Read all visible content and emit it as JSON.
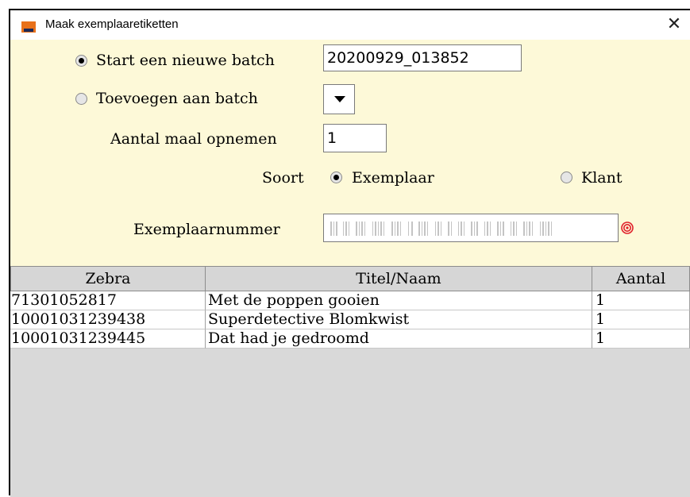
{
  "window": {
    "title": "Maak exemplaaretiketten",
    "close_label": "✕"
  },
  "form": {
    "new_batch": {
      "label": "Start een nieuwe batch",
      "checked": true,
      "value": "20200929_013852"
    },
    "add_to_batch": {
      "label": "Toevoegen aan batch",
      "checked": false,
      "selected": ""
    },
    "count": {
      "label": "Aantal maal opnemen",
      "value": "1"
    },
    "sort": {
      "label": "Soort",
      "options": [
        {
          "label": "Exemplaar",
          "checked": true
        },
        {
          "label": "Klant",
          "checked": false
        }
      ]
    },
    "item_number": {
      "label": "Exemplaarnummer",
      "value": ""
    }
  },
  "table": {
    "columns": [
      "Zebra",
      "Titel/Naam",
      "Aantal"
    ],
    "rows": [
      [
        "71301052817",
        "Met de poppen gooien",
        "1"
      ],
      [
        "10001031239438",
        "Superdetective Blomkwist",
        "1"
      ],
      [
        "10001031239445",
        "Dat had je gedroomd",
        "1"
      ]
    ]
  },
  "colors": {
    "form_background": "#fdf9d8",
    "table_background": "#d9d9d9",
    "icon_orange": "#e8711a",
    "target_red": "#e0202a"
  },
  "icons": {
    "app": "app-icon",
    "close": "close-icon",
    "dropdown": "chevron-down-icon",
    "barcode": "barcode-icon",
    "target": "target-icon"
  }
}
